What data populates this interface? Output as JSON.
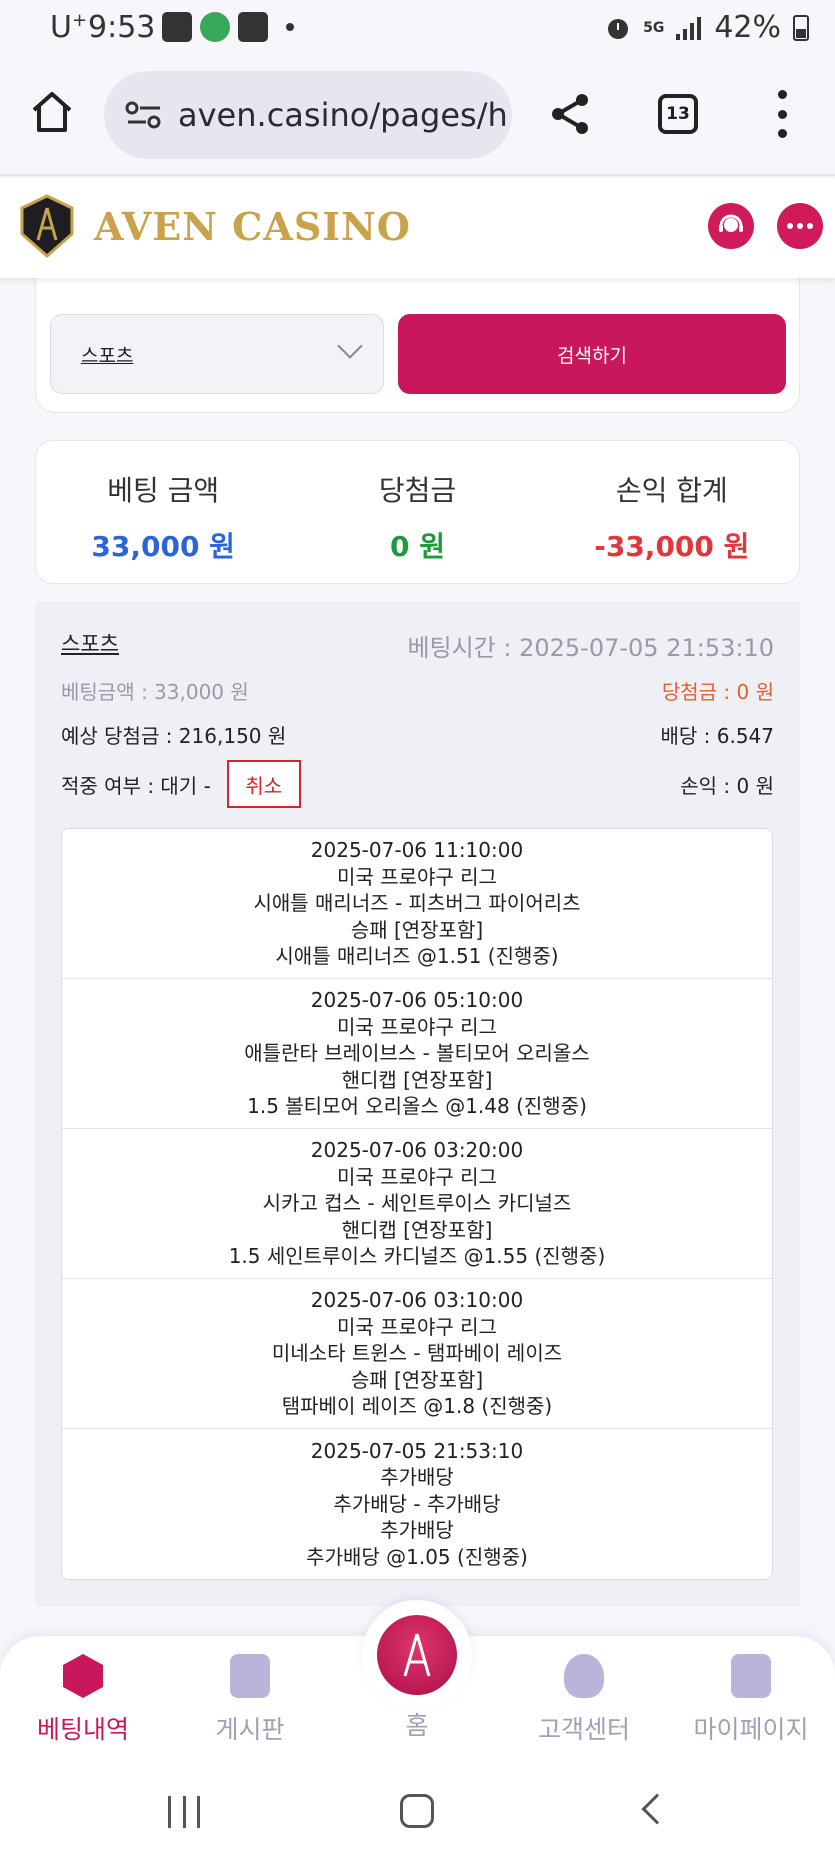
{
  "status_bar": {
    "carrier": "U",
    "carrier_sup": "+",
    "time": "9:53",
    "network": "5G",
    "battery": "42%"
  },
  "browser": {
    "url": "aven.casino/pages/h",
    "tab_count": "13"
  },
  "site": {
    "name": "AVEN CASINO",
    "brand_color": "#c8175b",
    "gold_color": "#c9a24a"
  },
  "search": {
    "category_selected": "스포츠",
    "button_label": "검색하기"
  },
  "summary": {
    "bet_amount_label": "베팅 금액",
    "bet_amount_value": "33,000 원",
    "winnings_label": "당첨금",
    "winnings_value": "0 원",
    "profit_label": "손익 합계",
    "profit_value": "-33,000 원"
  },
  "bet": {
    "category": "스포츠",
    "bet_time": "베팅시간 : 2025-07-05 21:53:10",
    "bet_amount": "베팅금액 : 33,000 원",
    "winnings": "당첨금 : 0 원",
    "expected_win": "예상 당첨금 : 216,150 원",
    "odds": "배당 : 6.547",
    "hit_status": "적중 여부 : 대기 -",
    "cancel_label": "취소",
    "profit": "손익 : 0 원",
    "games": [
      {
        "datetime": "2025-07-06 11:10:00",
        "league": "미국 프로야구 리그",
        "match": "시애틀 매리너즈 - 피츠버그 파이어리츠",
        "market": "승패 [연장포함]",
        "pick": "시애틀 매리너즈 @1.51 (진행중)"
      },
      {
        "datetime": "2025-07-06 05:10:00",
        "league": "미국 프로야구 리그",
        "match": "애틀란타 브레이브스 - 볼티모어 오리올스",
        "market": "핸디캡 [연장포함]",
        "pick": "1.5 볼티모어 오리올스 @1.48 (진행중)"
      },
      {
        "datetime": "2025-07-06 03:20:00",
        "league": "미국 프로야구 리그",
        "match": "시카고 컵스 - 세인트루이스 카디널즈",
        "market": "핸디캡 [연장포함]",
        "pick": "1.5 세인트루이스 카디널즈 @1.55 (진행중)"
      },
      {
        "datetime": "2025-07-06 03:10:00",
        "league": "미국 프로야구 리그",
        "match": "미네소타 트윈스 - 탬파베이 레이즈",
        "market": "승패 [연장포함]",
        "pick": "탬파베이 레이즈 @1.8 (진행중)"
      },
      {
        "datetime": "2025-07-05 21:53:10",
        "league": "추가배당",
        "match": "추가배당 - 추가배당",
        "market": "추가배당",
        "pick": "추가배당 @1.05 (진행중)"
      }
    ]
  },
  "bottom_nav": {
    "items": [
      {
        "label": "베팅내역",
        "icon": "bet-history-icon",
        "active": true
      },
      {
        "label": "게시판",
        "icon": "board-icon",
        "active": false
      },
      {
        "label": "홈",
        "icon": "home-logo-icon",
        "active": false
      },
      {
        "label": "고객센터",
        "icon": "headset-icon",
        "active": false
      },
      {
        "label": "마이페이지",
        "icon": "mypage-icon",
        "active": false
      }
    ]
  }
}
